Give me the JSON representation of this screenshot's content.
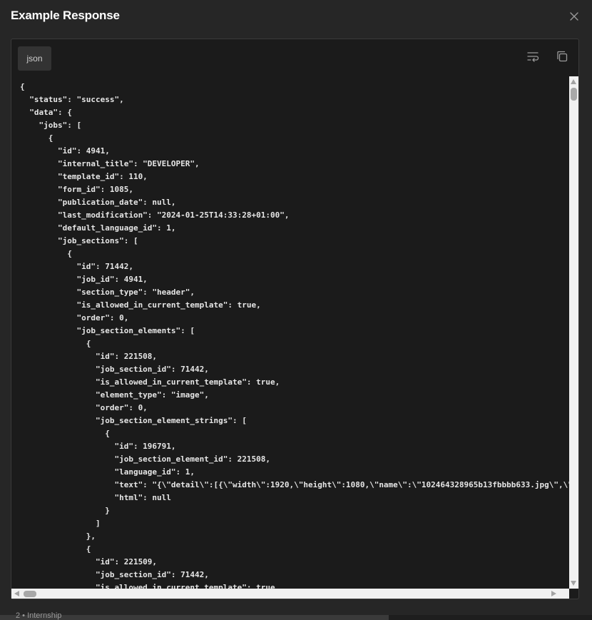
{
  "modal": {
    "title": "Example Response",
    "language_tab": "json"
  },
  "icons": {
    "close": "close-icon",
    "wrap": "wrap-lines-icon",
    "copy": "copy-icon"
  },
  "code": {
    "lines": [
      "{",
      "  \"status\": \"success\",",
      "  \"data\": {",
      "    \"jobs\": [",
      "      {",
      "        \"id\": 4941,",
      "        \"internal_title\": \"DEVELOPER\",",
      "        \"template_id\": 110,",
      "        \"form_id\": 1085,",
      "        \"publication_date\": null,",
      "        \"last_modification\": \"2024-01-25T14:33:28+01:00\",",
      "        \"default_language_id\": 1,",
      "        \"job_sections\": [",
      "          {",
      "            \"id\": 71442,",
      "            \"job_id\": 4941,",
      "            \"section_type\": \"header\",",
      "            \"is_allowed_in_current_template\": true,",
      "            \"order\": 0,",
      "            \"job_section_elements\": [",
      "              {",
      "                \"id\": 221508,",
      "                \"job_section_id\": 71442,",
      "                \"is_allowed_in_current_template\": true,",
      "                \"element_type\": \"image\",",
      "                \"order\": 0,",
      "                \"job_section_element_strings\": [",
      "                  {",
      "                    \"id\": 196791,",
      "                    \"job_section_element_id\": 221508,",
      "                    \"language_id\": 1,",
      "                    \"text\": \"{\\\"detail\\\":[{\\\"width\\\":1920,\\\"height\\\":1080,\\\"name\\\":\\\"102464328965b13fbbbb633.jpg\\\",\\\"",
      "                    \"html\": null",
      "                  }",
      "                ]",
      "              },",
      "              {",
      "                \"id\": 221509,",
      "                \"job_section_id\": 71442,",
      "                \"is_allowed_in_current_template\": true,"
    ]
  },
  "footer": {
    "text": "2  •  Internship"
  }
}
